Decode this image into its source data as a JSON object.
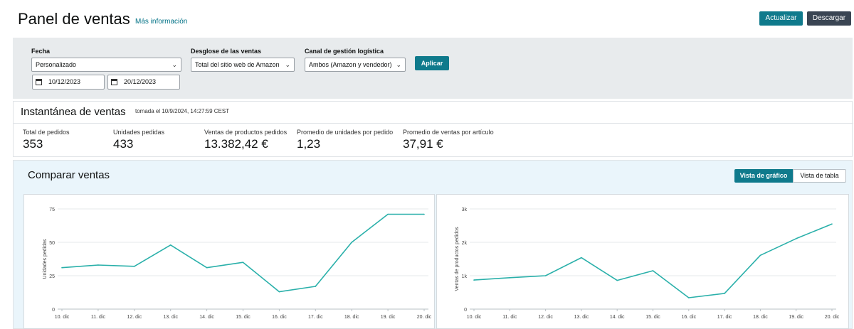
{
  "header": {
    "title": "Panel de ventas",
    "more_info": "Más información",
    "update_label": "Actualizar",
    "download_label": "Descargar"
  },
  "filters": {
    "date": {
      "label": "Fecha",
      "selected": "Personalizado",
      "start": "10/12/2023",
      "end": "20/12/2023"
    },
    "breakdown": {
      "label": "Desglose de las ventas",
      "selected": "Total del sitio web de Amazon"
    },
    "channel": {
      "label": "Canal de gestión logística",
      "selected": "Ambos (Amazon y vendedor)"
    },
    "apply_label": "Aplicar"
  },
  "snapshot": {
    "title": "Instantánea de ventas",
    "timestamp": "tomada el 10/9/2024, 14:27:59 CEST",
    "metrics": [
      {
        "label": "Total de pedidos",
        "value": "353"
      },
      {
        "label": "Unidades pedidas",
        "value": "433"
      },
      {
        "label": "Ventas de productos pedidos",
        "value": "13.382,42 €"
      },
      {
        "label": "Promedio de unidades por pedido",
        "value": "1,23"
      },
      {
        "label": "Promedio de ventas por artículo",
        "value": "37,91 €"
      }
    ]
  },
  "compare": {
    "title": "Comparar ventas",
    "graph_view_label": "Vista de gráfico",
    "table_view_label": "Vista de tabla"
  },
  "colors": {
    "accent": "#0f7a8c",
    "line": "#2ab0aa",
    "dark_button": "#3a4553"
  },
  "chart_data": [
    {
      "type": "line",
      "categories": [
        "10. dic",
        "11. dic",
        "12. dic",
        "13. dic",
        "14. dic",
        "15. dic",
        "16. dic",
        "17. dic",
        "18. dic",
        "19. dic",
        "20. dic"
      ],
      "series": [
        {
          "values": [
            31,
            33,
            32,
            48,
            31,
            35,
            13,
            17,
            50,
            71,
            71
          ]
        }
      ],
      "ylabel": "Unidades pedidas",
      "ylim": [
        0,
        75
      ],
      "yticks": [
        0,
        25,
        50,
        75
      ],
      "ytick_labels": [
        "0",
        "25",
        "50",
        "75"
      ],
      "grid": true
    },
    {
      "type": "line",
      "categories": [
        "10. dic",
        "11. dic",
        "12. dic",
        "13. dic",
        "14. dic",
        "15. dic",
        "16. dic",
        "17. dic",
        "18. dic",
        "19. dic",
        "20. dic"
      ],
      "series": [
        {
          "values": [
            870,
            940,
            1000,
            1540,
            860,
            1150,
            340,
            470,
            1610,
            2110,
            2550
          ]
        }
      ],
      "ylabel": "Ventas de productos pedidos",
      "ylim": [
        0,
        3000
      ],
      "yticks": [
        0,
        1000,
        2000,
        3000
      ],
      "ytick_labels": [
        "0",
        "1k",
        "2k",
        "3k"
      ],
      "grid": true
    }
  ]
}
